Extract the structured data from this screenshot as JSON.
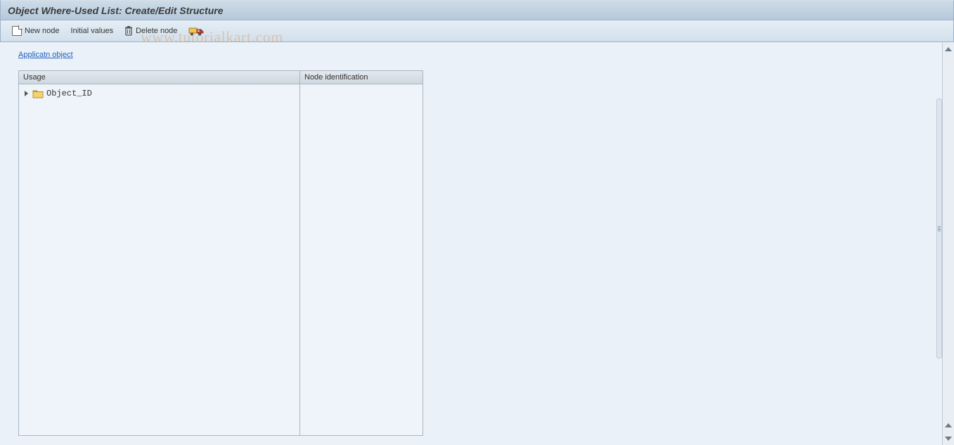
{
  "title": "Object Where-Used List: Create/Edit Structure",
  "toolbar": {
    "new_node": "New node",
    "initial_values": "Initial values",
    "delete_node": "Delete node"
  },
  "link": {
    "application_object": "Applicatn object"
  },
  "columns": {
    "usage": "Usage",
    "node_identification": "Node identification"
  },
  "tree": {
    "root_label": "Object_ID"
  },
  "watermark": "www.tutorialkart.com"
}
